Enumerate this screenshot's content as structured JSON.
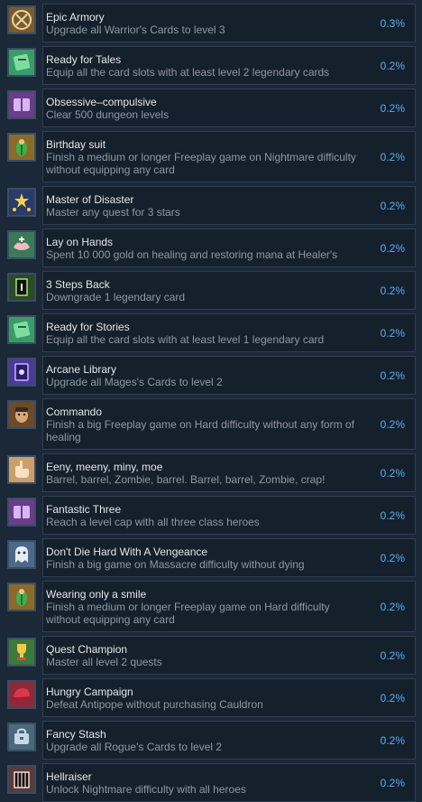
{
  "achievements": [
    {
      "title": "Epic Armory",
      "description": "Upgrade all Warrior's Cards to level 3",
      "percent": "0.3%",
      "icon": "armory-crest-icon",
      "icon_color": "#7a5a2e"
    },
    {
      "title": "Ready for Tales",
      "description": "Equip all the card slots with at least level 2 legendary cards",
      "percent": "0.2%",
      "icon": "green-card-icon",
      "icon_color": "#3a9a6a"
    },
    {
      "title": "Obsessive–compulsive",
      "description": "Clear 500 dungeon levels",
      "percent": "0.2%",
      "icon": "purple-book-icon",
      "icon_color": "#6a3d8a"
    },
    {
      "title": "Birthday suit",
      "description": "Finish a medium or longer Freeplay game on Nightmare difficulty without equipping any card",
      "percent": "0.2%",
      "icon": "leaf-figure-icon",
      "icon_color": "#8a6a2a"
    },
    {
      "title": "Master of Disaster",
      "description": "Master any quest for 3 stars",
      "percent": "0.2%",
      "icon": "three-stars-icon",
      "icon_color": "#2a3a6a"
    },
    {
      "title": "Lay on Hands",
      "description": "Spent 10 000 gold on healing and restoring mana at Healer's",
      "percent": "0.2%",
      "icon": "healing-hands-icon",
      "icon_color": "#3a7a5a"
    },
    {
      "title": "3 Steps Back",
      "description": "Downgrade 1 legendary card",
      "percent": "0.2%",
      "icon": "dark-doorway-icon",
      "icon_color": "#2a4a2a"
    },
    {
      "title": "Ready for Stories",
      "description": "Equip all the card slots with at least level 1 legendary card",
      "percent": "0.2%",
      "icon": "green-card-icon",
      "icon_color": "#3a9a6a"
    },
    {
      "title": "Arcane Library",
      "description": "Upgrade all Mages's Cards to level 2",
      "percent": "0.2%",
      "icon": "arcane-tome-icon",
      "icon_color": "#4a3a9a"
    },
    {
      "title": "Commando",
      "description": "Finish a big Freeplay game on Hard difficulty without any form of healing",
      "percent": "0.2%",
      "icon": "soldier-face-icon",
      "icon_color": "#6a4a2a"
    },
    {
      "title": "Eeny, meeny, miny, moe",
      "description": "Barrel, barrel, Zombie, barrel. Barrel, barrel, Zombie, crap!",
      "percent": "0.2%",
      "icon": "pointing-hand-icon",
      "icon_color": "#c8a070"
    },
    {
      "title": "Fantastic Three",
      "description": "Reach a level cap with all three class heroes",
      "percent": "0.2%",
      "icon": "purple-book-icon",
      "icon_color": "#6a3d8a"
    },
    {
      "title": "Don't Die Hard With A Vengeance",
      "description": "Finish a big game on Massacre difficulty without dying",
      "percent": "0.2%",
      "icon": "ghost-icon",
      "icon_color": "#4a6a8a"
    },
    {
      "title": "Wearing only a smile",
      "description": "Finish a medium or longer Freeplay game on Hard difficulty without equipping any card",
      "percent": "0.2%",
      "icon": "leaf-figure-icon",
      "icon_color": "#8a6a2a"
    },
    {
      "title": "Quest Champion",
      "description": "Master all level 2 quests",
      "percent": "0.2%",
      "icon": "champion-trophy-icon",
      "icon_color": "#3a7a3a"
    },
    {
      "title": "Hungry Campaign",
      "description": "Defeat Antipope without purchasing Cauldron",
      "percent": "0.2%",
      "icon": "red-cap-icon",
      "icon_color": "#8a2a3a"
    },
    {
      "title": "Fancy Stash",
      "description": "Upgrade all Rogue's Cards to level 2",
      "percent": "0.2%",
      "icon": "rogue-stash-icon",
      "icon_color": "#4a6a7a"
    },
    {
      "title": "Hellraiser",
      "description": "Unlock Nightmare difficulty with all heroes",
      "percent": "0.2%",
      "icon": "hell-gate-icon",
      "icon_color": "#5a3a3a"
    }
  ]
}
